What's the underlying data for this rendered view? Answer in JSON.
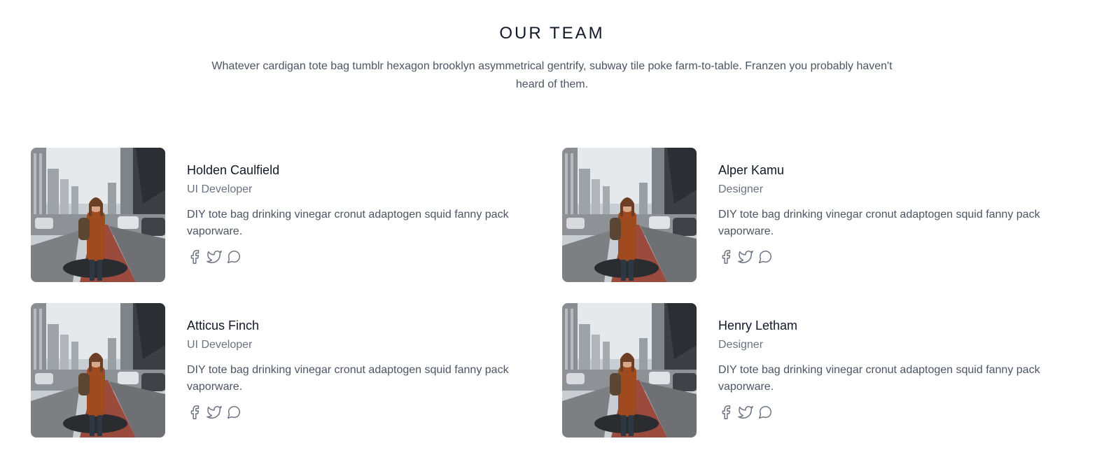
{
  "section": {
    "title": "OUR TEAM",
    "description": "Whatever cardigan tote bag tumblr hexagon brooklyn asymmetrical gentrify, subway tile poke farm-to-table. Franzen you probably haven't heard of them."
  },
  "members": [
    {
      "name": "Holden Caulfield",
      "role": "UI Developer",
      "bio": "DIY tote bag drinking vinegar cronut adaptogen squid fanny pack vaporware."
    },
    {
      "name": "Alper Kamu",
      "role": "Designer",
      "bio": "DIY tote bag drinking vinegar cronut adaptogen squid fanny pack vaporware."
    },
    {
      "name": "Atticus Finch",
      "role": "UI Developer",
      "bio": "DIY tote bag drinking vinegar cronut adaptogen squid fanny pack vaporware."
    },
    {
      "name": "Henry Letham",
      "role": "Designer",
      "bio": "DIY tote bag drinking vinegar cronut adaptogen squid fanny pack vaporware."
    }
  ],
  "social_icons": [
    "facebook-icon",
    "twitter-icon",
    "chat-icon"
  ],
  "colors": {
    "heading": "#111827",
    "body_text": "#4b5563",
    "muted_text": "#6b7280"
  }
}
